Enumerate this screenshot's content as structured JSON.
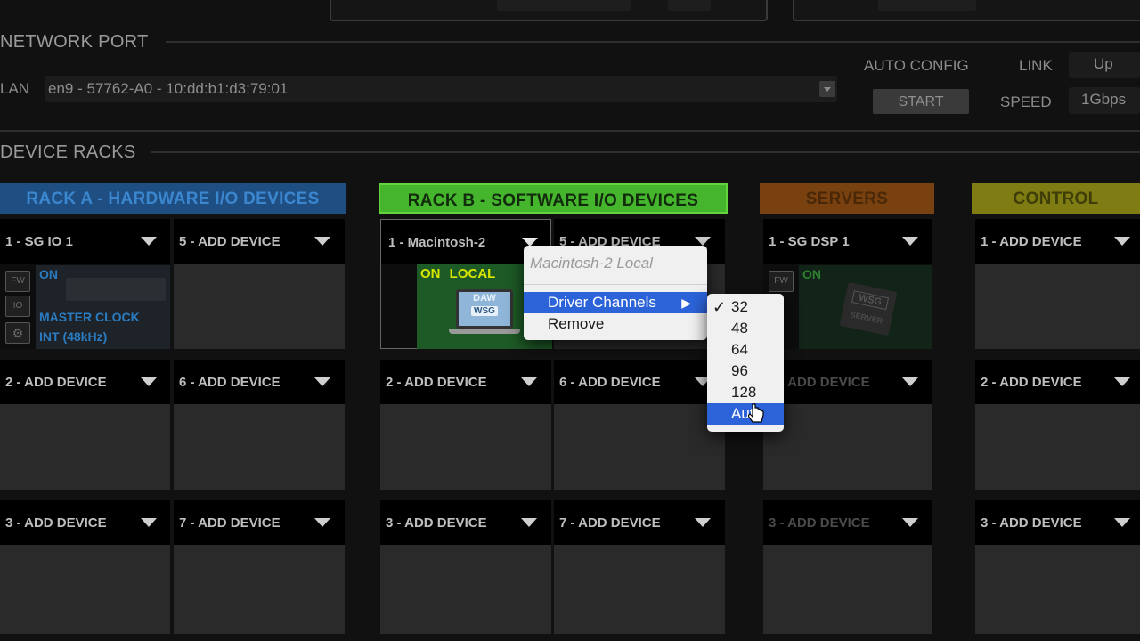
{
  "network_port": {
    "section_title": "NETWORK PORT",
    "lan_label": "LAN",
    "lan_value": "en9 - 57762-A0 - 10:dd:b1:d3:79:01",
    "auto_config_label": "AUTO CONFIG",
    "start_label": "START",
    "link_label": "LINK",
    "link_value": "Up",
    "speed_label": "SPEED",
    "speed_value": "1Gbps"
  },
  "device_racks": {
    "section_title": "DEVICE RACKS",
    "rack_a": {
      "title": "RACK A - HARDWARE I/O DEVICES",
      "color": "#2f6fb3",
      "slots": [
        "1 - SG IO 1",
        "5 - ADD DEVICE",
        "2 - ADD DEVICE",
        "6 - ADD DEVICE",
        "3 - ADD DEVICE",
        "7 - ADD DEVICE"
      ],
      "device": {
        "fw": "FW",
        "io": "IO",
        "status": "ON",
        "clock_line1": "MASTER CLOCK",
        "clock_line2": "INT (48kHz)"
      }
    },
    "rack_b": {
      "title": "RACK B - SOFTWARE I/O DEVICES",
      "color": "#46b52d",
      "slots": [
        "1 - Macintosh-2",
        "5 - ADD DEVICE",
        "2 - ADD DEVICE",
        "6 - ADD DEVICE",
        "3 - ADD DEVICE",
        "7 - ADD DEVICE"
      ],
      "device": {
        "status": "ON",
        "mode": "LOCAL",
        "daw": "DAW",
        "wsg": "WSG"
      }
    },
    "servers": {
      "title": "SERVERS",
      "color": "#8a4a12",
      "slots": [
        "1 - SG DSP 1",
        "2 - ADD DEVICE",
        "3 - ADD DEVICE"
      ],
      "device": {
        "fw": "FW",
        "status": "ON",
        "wsg": "WSG",
        "server": "SERVER"
      }
    },
    "control": {
      "title": "CONTROL",
      "color": "#8c8a14",
      "slots": [
        "1 - ADD DEVICE",
        "2 - ADD DEVICE",
        "3 - ADD DEVICE"
      ]
    }
  },
  "context_menu": {
    "header": "Macintosh-2 Local",
    "items": [
      "Driver Channels",
      "Remove"
    ]
  },
  "submenu": {
    "items": [
      "32",
      "48",
      "64",
      "96",
      "128",
      "Auto"
    ],
    "checked": "32",
    "highlighted": "Auto"
  }
}
